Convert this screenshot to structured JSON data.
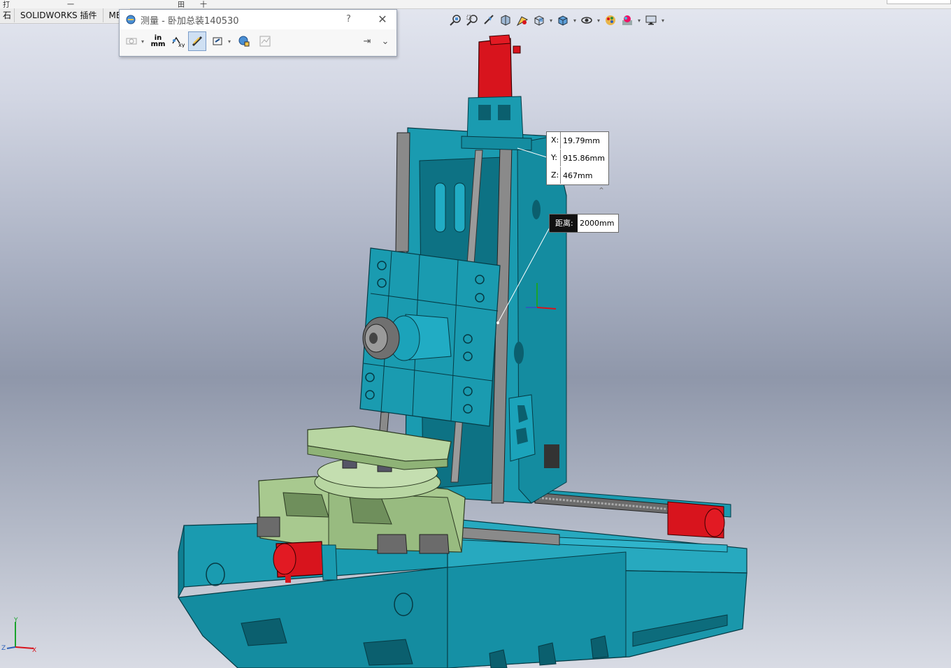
{
  "top_strip": {
    "fragments": [
      "打",
      "一",
      "田",
      "十"
    ]
  },
  "tabs": [
    {
      "label": "石"
    },
    {
      "label": "SOLIDWORKS 插件"
    },
    {
      "label": "MBI"
    }
  ],
  "measure_dialog": {
    "title": "测量 - 卧加总装140530",
    "help_label": "?",
    "close_label": "✕",
    "units_top": "in",
    "units_bottom": "mm",
    "pin_label": "⇥",
    "expand_label": "⌄"
  },
  "heads_up_toolbar": {
    "icons": [
      "zoom-to-fit-icon",
      "zoom-to-area-icon",
      "previous-view-icon",
      "section-view-icon",
      "dynamic-annotation-icon",
      "view-orientation-icon",
      "display-style-icon",
      "hide-show-items-icon",
      "edit-appearance-icon",
      "apply-scene-icon",
      "view-settings-icon"
    ]
  },
  "coordinates": {
    "x_label": "X:",
    "x_value": "19.79mm",
    "y_label": "Y:",
    "y_value": "915.86mm",
    "z_label": "Z:",
    "z_value": "467mm"
  },
  "distance": {
    "label": "距离:",
    "value": "2000mm"
  },
  "triad": {
    "x": "X",
    "y": "Y",
    "z": "Z"
  },
  "colors": {
    "machine_teal": "#1a9bb0",
    "motor_red": "#d8141d",
    "table_green": "#b8d6a2",
    "guide_gray": "#8a8a8a"
  }
}
